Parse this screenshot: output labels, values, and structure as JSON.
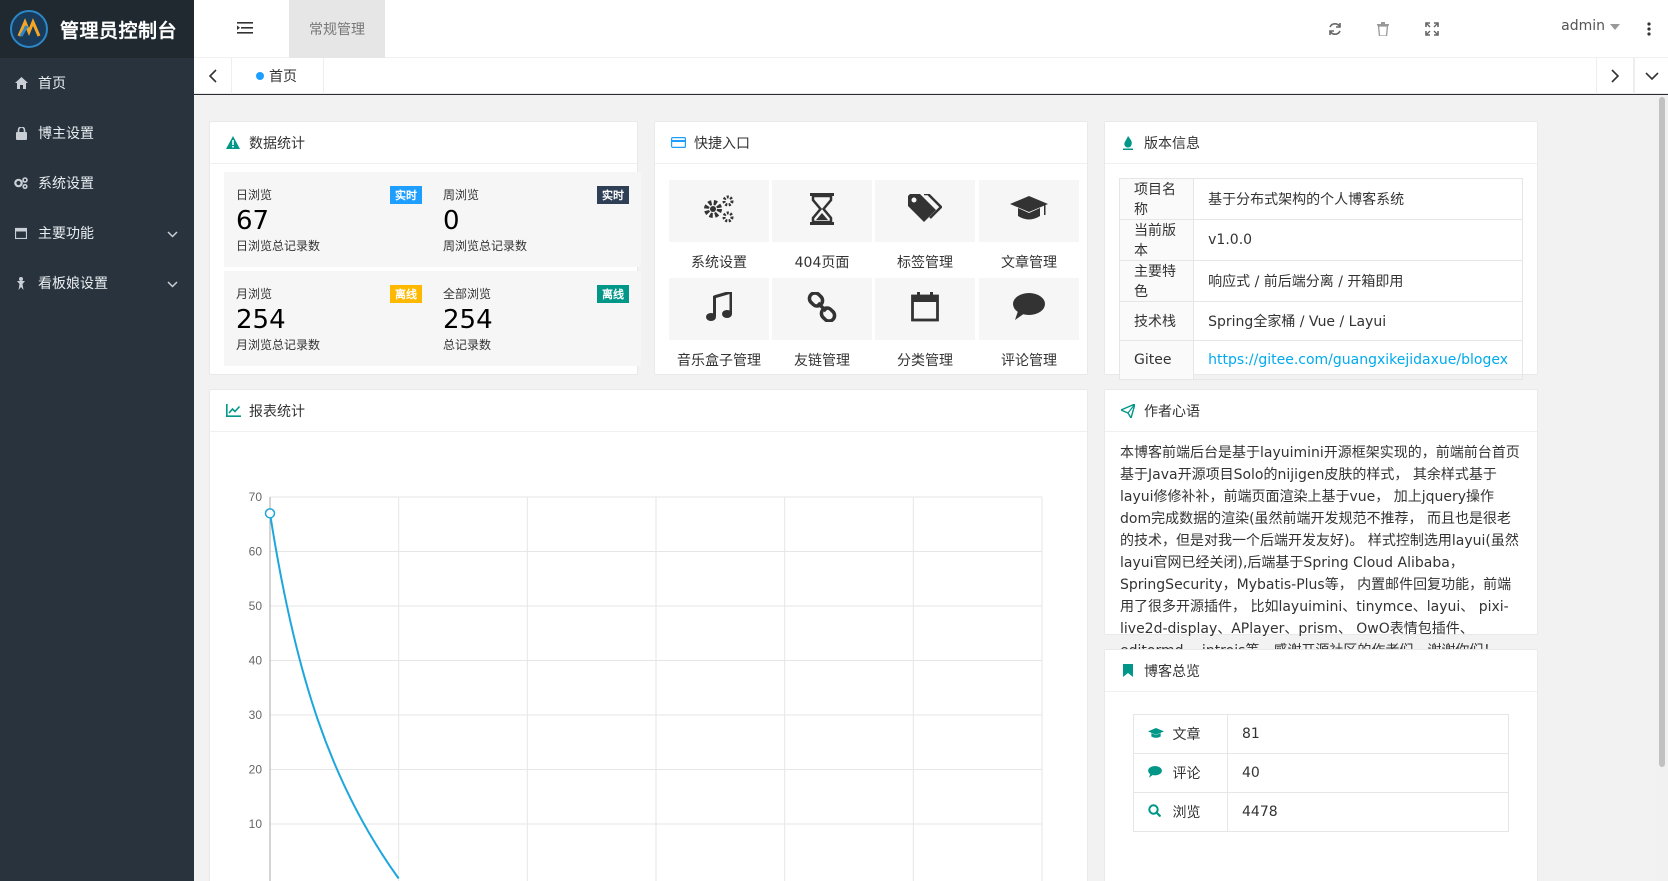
{
  "app": {
    "title": "管理员控制台"
  },
  "sidebar": {
    "items": [
      {
        "label": "首页",
        "icon": "home-icon"
      },
      {
        "label": "博主设置",
        "icon": "user-lock-icon"
      },
      {
        "label": "系统设置",
        "icon": "gears-icon"
      },
      {
        "label": "主要功能",
        "icon": "calendar-icon",
        "expandable": true
      },
      {
        "label": "看板娘设置",
        "icon": "figure-icon",
        "expandable": true
      }
    ]
  },
  "header": {
    "tab": "常规管理",
    "user": "admin"
  },
  "tabbar": {
    "home": "首页"
  },
  "stats": {
    "title": "数据统计",
    "items": [
      {
        "name": "日浏览",
        "value": "67",
        "desc": "日浏览总记录数",
        "badge": "实时",
        "badge_color": "#1e9fff"
      },
      {
        "name": "周浏览",
        "value": "0",
        "desc": "周浏览总记录数",
        "badge": "实时",
        "badge_color": "#2f4056"
      },
      {
        "name": "月浏览",
        "value": "254",
        "desc": "月浏览总记录数",
        "badge": "离线",
        "badge_color": "#ffb800"
      },
      {
        "name": "全部浏览",
        "value": "254",
        "desc": "总记录数",
        "badge": "离线",
        "badge_color": "#009688"
      }
    ]
  },
  "quick": {
    "title": "快捷入口",
    "items": [
      {
        "label": "系统设置",
        "icon": "gears-icon"
      },
      {
        "label": "404页面",
        "icon": "hourglass-icon"
      },
      {
        "label": "标签管理",
        "icon": "tags-icon"
      },
      {
        "label": "文章管理",
        "icon": "graduation-cap-icon"
      },
      {
        "label": "音乐盒子管理",
        "icon": "music-icon"
      },
      {
        "label": "友链管理",
        "icon": "chain-icon"
      },
      {
        "label": "分类管理",
        "icon": "calendar-icon"
      },
      {
        "label": "评论管理",
        "icon": "comment-icon"
      }
    ]
  },
  "version": {
    "title": "版本信息",
    "rows": [
      {
        "k": "项目名称",
        "v": "基于分布式架构的个人博客系统"
      },
      {
        "k": "当前版本",
        "v": "v1.0.0"
      },
      {
        "k": "主要特色",
        "v": "响应式 / 前后端分离 / 开箱即用"
      },
      {
        "k": "技术栈",
        "v": "Spring全家桶 / Vue / Layui"
      },
      {
        "k": "Gitee",
        "v": "https://gitee.com/guangxikejidaxue/blogex"
      }
    ]
  },
  "report": {
    "title": "报表统计"
  },
  "chart_data": {
    "type": "line",
    "y_ticks": [
      10,
      20,
      30,
      40,
      50,
      60,
      70
    ],
    "ylim": [
      0,
      70
    ],
    "series": [
      {
        "values": [
          67,
          0,
          0,
          0,
          0,
          0,
          0
        ]
      }
    ],
    "grid": true,
    "line_color": "#1ea7dd"
  },
  "author": {
    "title": "作者心语",
    "text": "本博客前端后台是基于layuimini开源框架实现的，前端前台首页基于Java开源项目Solo的nijigen皮肤的样式， 其余样式基于layui修修补补，前端页面渲染上基于vue， 加上jquery操作dom完成数据的渲染(虽然前端开发规范不推荐， 而且也是很老的技术，但是对我一个后端开发友好)。 样式控制选用layui(虽然layui官网已经关闭),后端基于Spring Cloud Alibaba， SpringSecurity，Mybatis-Plus等， 内置邮件回复功能，前端用了很多开源插件， 比如layuimini、tinymce、layui、 pixi-live2d-display、APlayer、prism、 OwO表情包插件、editormd、 introjs等，感谢开源社区的作者们，谢谢你们！"
  },
  "overview": {
    "title": "博客总览",
    "rows": [
      {
        "k": "文章",
        "v": "81",
        "icon": "graduation-cap-icon"
      },
      {
        "k": "评论",
        "v": "40",
        "icon": "comment-icon"
      },
      {
        "k": "浏览",
        "v": "4478",
        "icon": "search-icon"
      }
    ]
  },
  "colors": {
    "accent": "#009688",
    "sidebar": "#28333e",
    "link": "#01aaed"
  }
}
